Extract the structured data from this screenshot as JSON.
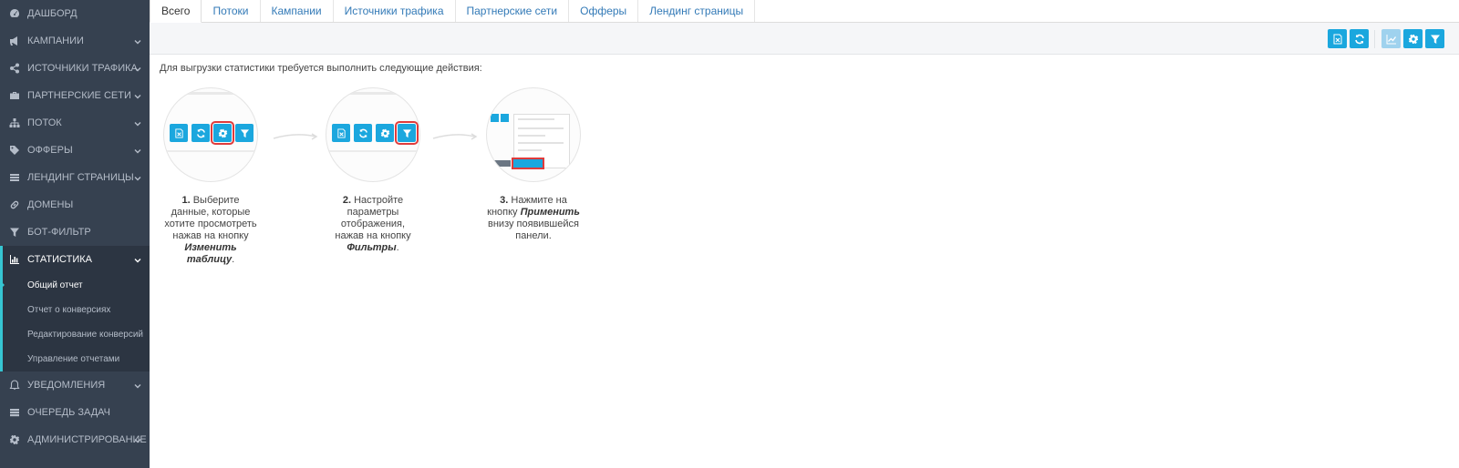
{
  "sidebar": {
    "items": [
      {
        "label": "ДАШБОРД",
        "icon": "dashboard-icon"
      },
      {
        "label": "КАМПАНИИ",
        "icon": "bullhorn-icon"
      },
      {
        "label": "ИСТОЧНИКИ ТРАФИКА",
        "icon": "share-icon"
      },
      {
        "label": "ПАРТНЕРСКИЕ СЕТИ",
        "icon": "briefcase-icon"
      },
      {
        "label": "ПОТОК",
        "icon": "sitemap-icon"
      },
      {
        "label": "ОФФЕРЫ",
        "icon": "tags-icon"
      },
      {
        "label": "ЛЕНДИНГ СТРАНИЦЫ",
        "icon": "list-icon"
      },
      {
        "label": "ДОМЕНЫ",
        "icon": "link-icon"
      },
      {
        "label": "БОТ-ФИЛЬТР",
        "icon": "filter-icon"
      },
      {
        "label": "СТАТИСТИКА",
        "icon": "bar-chart-icon"
      },
      {
        "label": "УВЕДОМЛЕНИЯ",
        "icon": "bell-icon"
      },
      {
        "label": "ОЧЕРЕДЬ ЗАДАЧ",
        "icon": "tasks-icon"
      },
      {
        "label": "АДМИНИСТРИРОВАНИЕ",
        "icon": "cog-icon"
      }
    ],
    "stats_sub": [
      {
        "label": "Общий отчет"
      },
      {
        "label": "Отчет о конверсиях"
      },
      {
        "label": "Редактирование конверсий"
      },
      {
        "label": "Управление отчетами"
      }
    ]
  },
  "tabs": [
    "Всего",
    "Потоки",
    "Кампании",
    "Источники трафика",
    "Партнерские сети",
    "Офферы",
    "Лендинг страницы"
  ],
  "intro": "Для выгрузки статистики требуется выполнить следующие действия:",
  "steps": [
    {
      "num": "1.",
      "a": " Выберите данные, которые хотите просмотреть нажав на кнопку ",
      "em": "Изменить таблицу",
      "b": "."
    },
    {
      "num": "2.",
      "a": " Настройте параметры отображения, нажав на кнопку ",
      "em": "Фильтры",
      "b": "."
    },
    {
      "num": "3.",
      "a": " Нажмите на кнопку ",
      "em": "Применить",
      "b": " внизу появившейся панели."
    }
  ],
  "colors": {
    "sidebar": "#364150",
    "accent": "#1ba7de",
    "highlight": "#e03b3b",
    "active_border": "#36c6d3"
  }
}
